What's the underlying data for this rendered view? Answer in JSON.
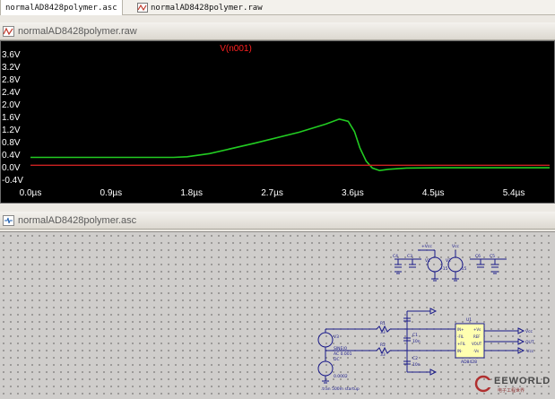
{
  "tabs": [
    {
      "label": "normalAD8428polymer.asc",
      "active": true,
      "icon": "schematic-icon"
    },
    {
      "label": "normalAD8428polymer.raw",
      "active": false,
      "icon": "waveform-icon"
    }
  ],
  "waveform_window": {
    "title": "normalAD8428polymer.raw",
    "icon": "waveform-icon"
  },
  "schematic_window": {
    "title": "normalAD8428polymer.asc",
    "icon": "schematic-icon"
  },
  "chart_data": {
    "type": "line",
    "title": "",
    "trace_label": "V(n001)",
    "trace_label_color": "#ff2020",
    "trace_color": "#22cc22",
    "xlabel": "",
    "ylabel": "",
    "x_ticks": [
      "0.0µs",
      "0.9µs",
      "1.8µs",
      "2.7µs",
      "3.6µs",
      "4.5µs",
      "5.4µs"
    ],
    "y_ticks": [
      "3.6V",
      "3.2V",
      "2.8V",
      "2.4V",
      "2.0V",
      "1.6V",
      "1.2V",
      "0.8V",
      "0.4V",
      "0.0V",
      "-0.4V"
    ],
    "xlim": [
      0,
      5.8
    ],
    "ylim": [
      -0.4,
      3.6
    ],
    "x_unit": "µs",
    "y_unit": "V",
    "background": "#000000",
    "grid": false,
    "series": [
      {
        "name": "V(n001)",
        "color": "#22cc22",
        "x": [
          0.0,
          1.0,
          1.6,
          1.75,
          2.0,
          2.5,
          3.0,
          3.3,
          3.45,
          3.55,
          3.62,
          3.68,
          3.75,
          3.82,
          3.9,
          4.0,
          4.2,
          4.6,
          5.0,
          5.8
        ],
        "y": [
          0.3,
          0.3,
          0.3,
          0.32,
          0.42,
          0.75,
          1.1,
          1.36,
          1.52,
          1.45,
          1.12,
          0.6,
          0.18,
          -0.04,
          -0.12,
          -0.08,
          -0.04,
          -0.03,
          -0.03,
          -0.03
        ]
      },
      {
        "name": "reference",
        "color": "#cc2222",
        "x": [
          0.0,
          5.8
        ],
        "y": [
          0.05,
          0.05
        ]
      }
    ]
  },
  "schematic": {
    "labels": {
      "vcc_top": "+Vcc",
      "vcc_top2": "Vcc",
      "v1_ref": "V1",
      "v2_ref": "V2",
      "v1_val": "+15",
      "v2_val": "-15",
      "c_ref_a": "C4",
      "c_ref_b": "C3",
      "c_ref_c": "C6",
      "c_ref_d": "C5",
      "r1": "R1",
      "r2": "R2",
      "r_val": "33",
      "c1": "C1",
      "c2": "C2",
      "c_val": "10n",
      "u1": "U1",
      "part": "AD8428",
      "pin_in_plus": "IN+",
      "pin_fil_minus": "-FIL",
      "pin_fil_plus": "+FIL",
      "pin_in_minus": "IN-",
      "pin_vs_plus": "+Vs",
      "pin_ref": "REF",
      "pin_vout": "VOUT",
      "pin_vs_minus": "-Vs",
      "net_vcc": "Vcc",
      "net_out": "OUT",
      "net_vcc2": "-Vcc",
      "v3": "V3",
      "v3_sine": "SINE(0",
      "v3_ac": "AC 0.001",
      "v3_dc": "DC",
      "v4_val": "0.0002",
      "tran": ".tran 500m startup"
    }
  },
  "watermark": {
    "brand": "EEWORLD",
    "sub": "电子工程世界"
  }
}
